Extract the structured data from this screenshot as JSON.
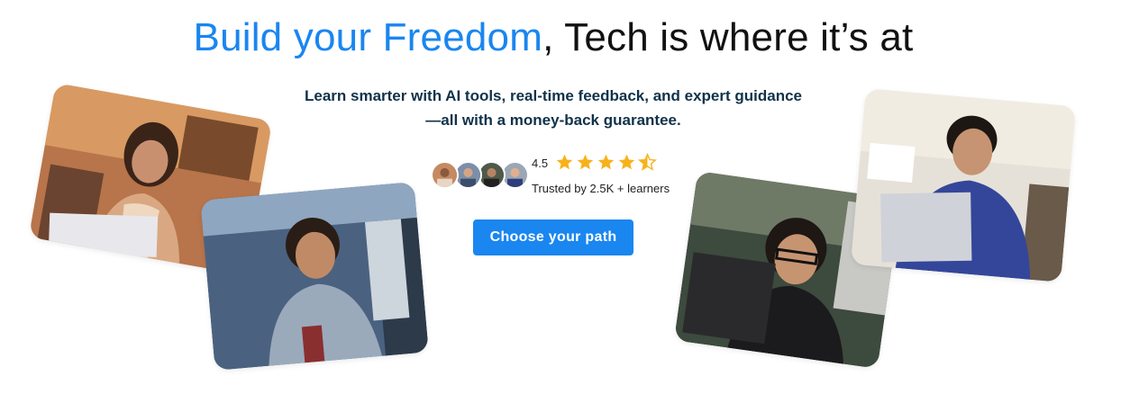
{
  "hero": {
    "headline_accent": "Build your Freedom",
    "headline_rest": ", Tech is where it’s at",
    "subheadline_line1": "Learn smarter with AI tools, real-time feedback, and expert guidance",
    "subheadline_line2": "—all with a money-back guarantee.",
    "cta_label": "Choose your path"
  },
  "rating": {
    "value": "4.5",
    "stars_out_of_5": 4.5,
    "trusted_text": "Trusted by 2.5K + learners"
  },
  "colors": {
    "accent": "#1a86f0",
    "headline": "#111111",
    "subheadline": "#10324a",
    "star": "#f7b21a",
    "button_text": "#ffffff"
  },
  "icons": {
    "star_full": "star-icon",
    "star_half": "star-half-icon"
  }
}
